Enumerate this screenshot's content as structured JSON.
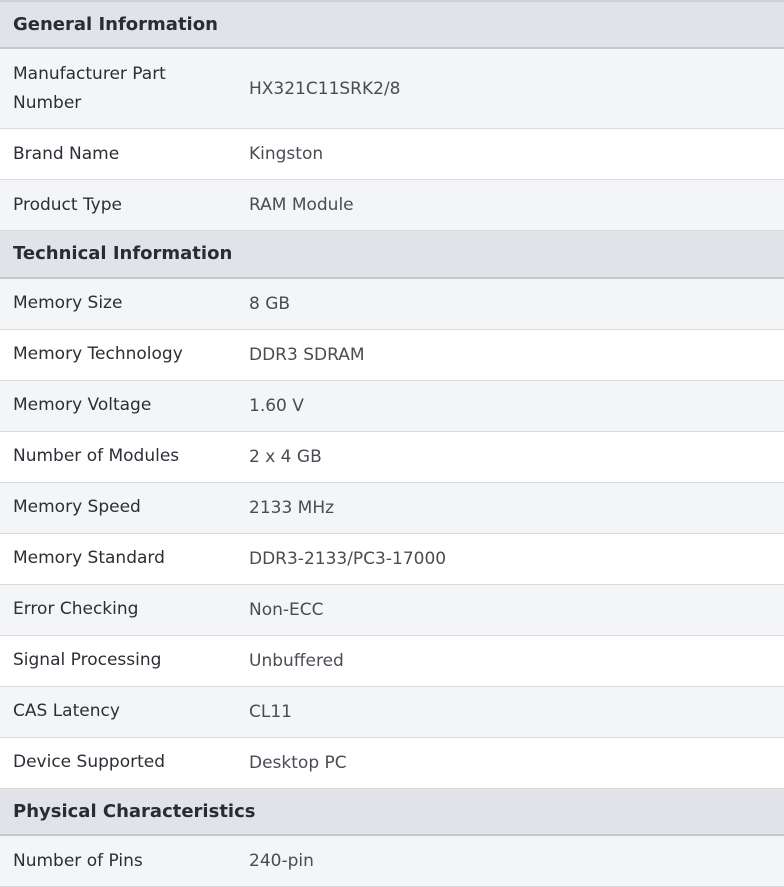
{
  "sections": [
    {
      "title": "General Information",
      "rows": [
        {
          "label": "Manufacturer Part Number",
          "value": "HX321C11SRK2/8"
        },
        {
          "label": "Brand Name",
          "value": "Kingston"
        },
        {
          "label": "Product Type",
          "value": "RAM Module"
        }
      ]
    },
    {
      "title": "Technical Information",
      "rows": [
        {
          "label": "Memory Size",
          "value": "8 GB"
        },
        {
          "label": "Memory Technology",
          "value": "DDR3 SDRAM"
        },
        {
          "label": "Memory Voltage",
          "value": "1.60 V"
        },
        {
          "label": "Number of Modules",
          "value": "2 x 4 GB"
        },
        {
          "label": "Memory Speed",
          "value": "2133 MHz"
        },
        {
          "label": "Memory Standard",
          "value": "DDR3-2133/PC3-17000"
        },
        {
          "label": "Error Checking",
          "value": "Non-ECC"
        },
        {
          "label": "Signal Processing",
          "value": "Unbuffered"
        },
        {
          "label": "CAS Latency",
          "value": "CL11"
        },
        {
          "label": "Device Supported",
          "value": "Desktop PC"
        }
      ]
    },
    {
      "title": "Physical Characteristics",
      "rows": [
        {
          "label": "Number of Pins",
          "value": "240-pin"
        }
      ]
    }
  ]
}
